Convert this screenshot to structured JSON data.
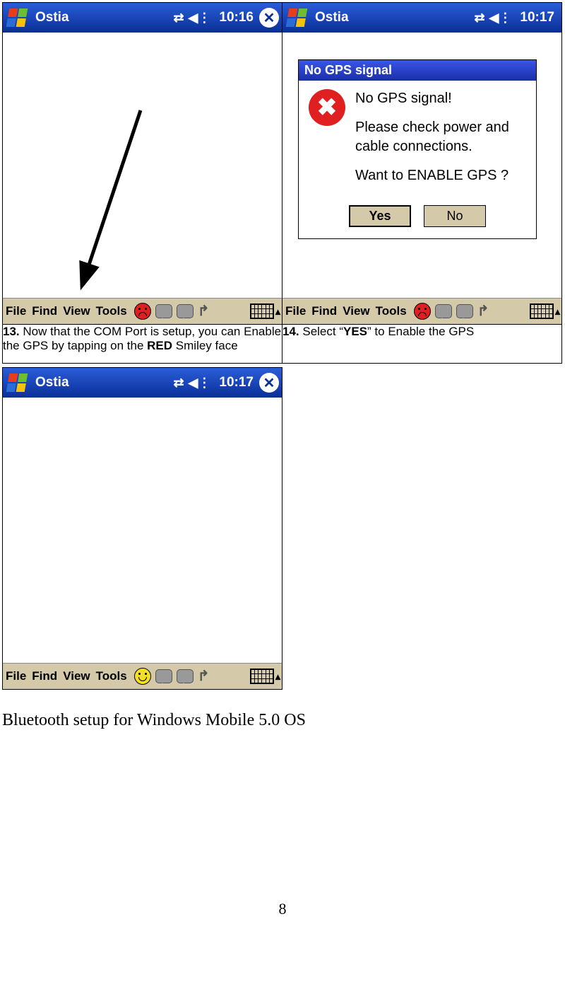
{
  "screens": {
    "s1": {
      "title": "Ostia",
      "time": "10:16"
    },
    "s2": {
      "title": "Ostia",
      "time": "10:17"
    },
    "s3": {
      "title": "Ostia",
      "time": "10:17"
    }
  },
  "bottombar": {
    "file": "File",
    "find": "Find",
    "view": "View",
    "tools": "Tools"
  },
  "dialog": {
    "title": "No GPS signal",
    "line1": "No GPS signal!",
    "line2": "Please check power and cable connections.",
    "line3": "Want to ENABLE GPS ?",
    "yes": "Yes",
    "no": "No"
  },
  "captions": {
    "c13_num": "13.",
    "c13_a": " Now that the COM Port is setup, you can Enable the GPS by tapping on the ",
    "c13_b": "RED",
    "c13_c": " Smiley face",
    "c14_num": "14.",
    "c14_a": " Select “",
    "c14_b": "YES",
    "c14_c": "” to Enable the GPS"
  },
  "heading": "Bluetooth setup for Windows Mobile 5.0 OS",
  "pageNumber": "8"
}
